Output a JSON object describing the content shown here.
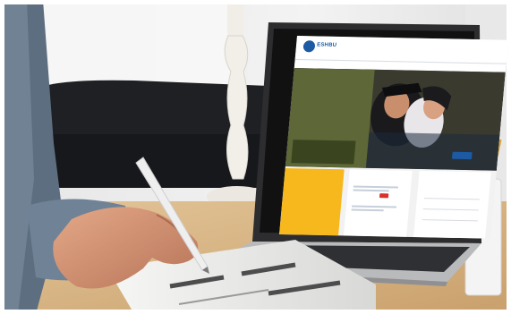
{
  "scene": {
    "description_title": "",
    "colors": {
      "wall": "#ececec",
      "laptop_body": "#3a3a3c",
      "sofa": "#1e2024",
      "table": "#d9b789",
      "site_blue": "#1c5aa3",
      "site_yellow": "#f6b81c"
    }
  },
  "website": {
    "logo_text": "ESHBU",
    "org_name": "",
    "header_links": "",
    "header_links_2": "",
    "nav_items": [
      "",
      "",
      "",
      "",
      "",
      "",
      ""
    ],
    "hero": {
      "kicker": "",
      "title": "",
      "text": "",
      "button": ""
    },
    "promo": {
      "line1": "",
      "line2": "",
      "date": ""
    },
    "news": {
      "heading": ""
    },
    "info": {
      "heading": "",
      "rows": [
        "",
        "",
        ""
      ]
    }
  }
}
